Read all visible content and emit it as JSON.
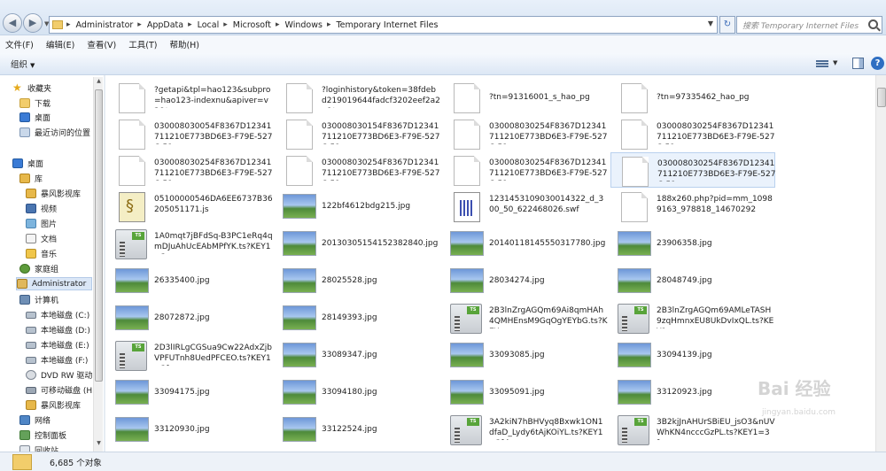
{
  "address": {
    "crumbs": [
      "Administrator",
      "AppData",
      "Local",
      "Microsoft",
      "Windows",
      "Temporary Internet Files"
    ],
    "search_placeholder": "搜索 Temporary Internet Files"
  },
  "menu": [
    "文件(F)",
    "编辑(E)",
    "查看(V)",
    "工具(T)",
    "帮助(H)"
  ],
  "toolbar": {
    "organize": "组织"
  },
  "nav": [
    {
      "label": "收藏夹",
      "icon": "star-icon"
    },
    {
      "label": "下载",
      "icon": "folder-icon"
    },
    {
      "label": "桌面",
      "icon": "desktop-icon"
    },
    {
      "label": "最近访问的位置",
      "icon": "recent-places-icon"
    },
    {
      "label": "桌面",
      "icon": "desktop-icon"
    },
    {
      "label": "库",
      "icon": "library-icon"
    },
    {
      "label": "暴风影视库",
      "icon": "library-icon"
    },
    {
      "label": "视频",
      "icon": "video-icon"
    },
    {
      "label": "图片",
      "icon": "pictures-icon"
    },
    {
      "label": "文档",
      "icon": "documents-icon"
    },
    {
      "label": "音乐",
      "icon": "music-icon"
    },
    {
      "label": "家庭组",
      "icon": "homegroup-icon"
    },
    {
      "label": "Administrator",
      "icon": "user-folder-icon"
    },
    {
      "label": "计算机",
      "icon": "computer-icon"
    },
    {
      "label": "本地磁盘 (C:)",
      "icon": "drive-icon"
    },
    {
      "label": "本地磁盘 (D:)",
      "icon": "drive-icon"
    },
    {
      "label": "本地磁盘 (E:)",
      "icon": "drive-icon"
    },
    {
      "label": "本地磁盘 (F:)",
      "icon": "drive-icon"
    },
    {
      "label": "DVD RW 驱动",
      "icon": "dvd-drive-icon"
    },
    {
      "label": "可移动磁盘 (H:",
      "icon": "removable-drive-icon"
    },
    {
      "label": "暴风影视库",
      "icon": "library-icon"
    },
    {
      "label": "网络",
      "icon": "network-icon"
    },
    {
      "label": "控制面板",
      "icon": "control-panel-icon"
    },
    {
      "label": "回收站",
      "icon": "recycle-bin-icon"
    }
  ],
  "files": [
    {
      "name": "?getapi&tpl=hao123&subpro=hao123-indexnu&apiver=v3&t...",
      "type": "doc"
    },
    {
      "name": "?loginhistory&token=38fdebd219019644fadcf3202eef2a2a&t...",
      "type": "doc"
    },
    {
      "name": "?tn=91316001_s_hao_pg",
      "type": "doc"
    },
    {
      "name": "?tn=97335462_hao_pg",
      "type": "doc"
    },
    {
      "name": "030008030054F8367D12341711210E773BD6E3-F79E-527C-51...",
      "type": "doc"
    },
    {
      "name": "030008030154F8367D12341711210E773BD6E3-F79E-527C-51...",
      "type": "doc"
    },
    {
      "name": "030008030254F8367D12341711210E773BD6E3-F79E-527C-51...",
      "type": "doc"
    },
    {
      "name": "030008030254F8367D12341711210E773BD6E3-F79E-527C-51...",
      "type": "doc"
    },
    {
      "name": "030008030254F8367D12341711210E773BD6E3-F79E-527C-51...",
      "type": "doc"
    },
    {
      "name": "030008030254F8367D12341711210E773BD6E3-F79E-527C-51...",
      "type": "doc"
    },
    {
      "name": "030008030254F8367D12341711210E773BD6E3-F79E-527C-51...",
      "type": "doc"
    },
    {
      "name": "030008030254F8367D12341711210E773BD6E3-F79E-527C-51...",
      "type": "doc"
    },
    {
      "name": "05100000546DA6EE6737B36205051171.js",
      "type": "js"
    },
    {
      "name": "122bf4612bdg215.jpg",
      "type": "img"
    },
    {
      "name": "1231453109030014322_d_300_50_622468026.swf",
      "type": "swf"
    },
    {
      "name": "188x260.php?pid=mm_10989163_978818_14670292",
      "type": "doc"
    },
    {
      "name": "1A0mqt7jBFdSq-B3PC1eRq4qmDJuAhUcEAbMPfYK.ts?KEY1=3...",
      "type": "ts"
    },
    {
      "name": "20130305154152382840.jpg",
      "type": "img"
    },
    {
      "name": "20140118145550317780.jpg",
      "type": "img"
    },
    {
      "name": "23906358.jpg",
      "type": "img"
    },
    {
      "name": "26335400.jpg",
      "type": "img"
    },
    {
      "name": "28025528.jpg",
      "type": "img"
    },
    {
      "name": "28034274.jpg",
      "type": "img"
    },
    {
      "name": "28048749.jpg",
      "type": "img"
    },
    {
      "name": "28072872.jpg",
      "type": "img"
    },
    {
      "name": "28149393.jpg",
      "type": "img"
    },
    {
      "name": "2B3lnZrgAGQm69Ai8qmHAh4QMHEnsM9GqOgYEYbG.ts?KEY...",
      "type": "ts"
    },
    {
      "name": "2B3lnZrgAGQm69AMLeTASH9zqHmnxEU8UkDvIxQL.ts?KEY1=...",
      "type": "ts"
    },
    {
      "name": "2D3lIRLgCGSua9Cw22AdxZjbVPFUTnh8UedPFCEO.ts?KEY1=3f...",
      "type": "ts"
    },
    {
      "name": "33089347.jpg",
      "type": "img"
    },
    {
      "name": "33093085.jpg",
      "type": "img"
    },
    {
      "name": "33094139.jpg",
      "type": "img"
    },
    {
      "name": "33094175.jpg",
      "type": "img"
    },
    {
      "name": "33094180.jpg",
      "type": "img"
    },
    {
      "name": "33095091.jpg",
      "type": "img"
    },
    {
      "name": "33120923.jpg",
      "type": "img"
    },
    {
      "name": "33120930.jpg",
      "type": "img"
    },
    {
      "name": "33122524.jpg",
      "type": "img"
    },
    {
      "name": "3A2kiN7hBHVyq8Bxwk1ON1dfaD_Lydy6tAjKOiYL.ts?KEY1=3fdc...",
      "type": "ts"
    },
    {
      "name": "3B2kjJnAHUrSBiEU_jsO3&nUVWhKN4ncccGzPL.ts?KEY1=3f...",
      "type": "ts"
    }
  ],
  "status": {
    "count": "6,685 个对象"
  },
  "watermark": {
    "logo": "Bai 经验",
    "url": "jingyan.baidu.com"
  }
}
